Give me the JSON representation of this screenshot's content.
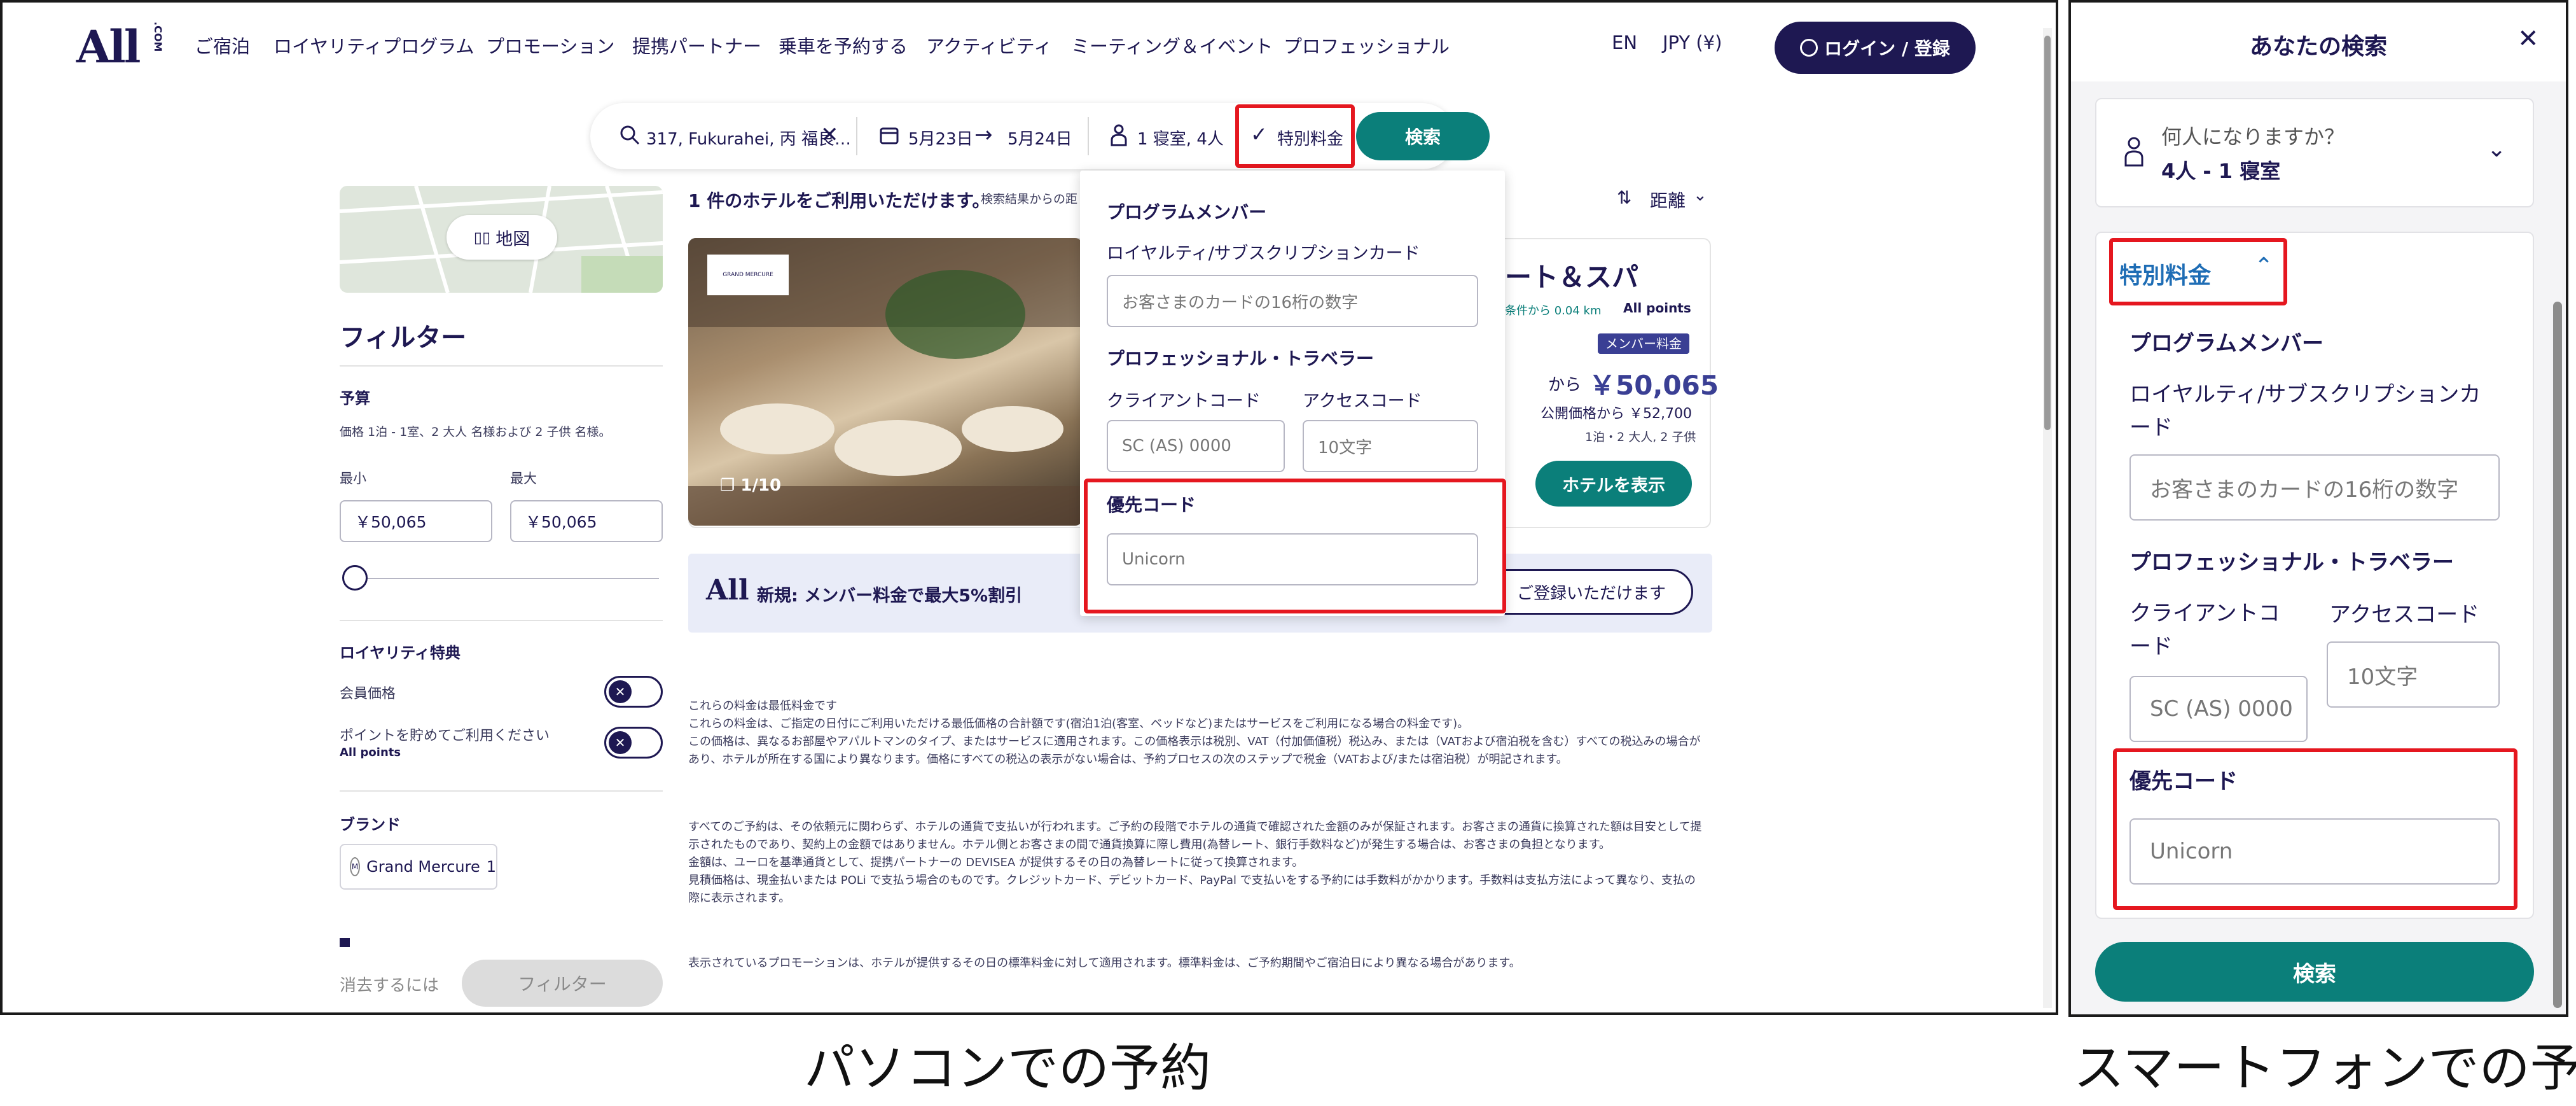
{
  "desktop": {
    "logo": "All",
    "logo_suffix": ".COM",
    "nav": [
      "ご宿泊",
      "ロイヤリティプログラム",
      "プロモーション",
      "提携パートナー",
      "乗車を予約する",
      "アクティビティ",
      "ミーティング＆イベント",
      "プロフェッショナル"
    ],
    "lang": "EN",
    "currency": "JPY (¥)",
    "login_label": "ログイン / 登録",
    "search": {
      "destination": "317, Fukurahei, 丙 福良…",
      "checkin": "5月23日",
      "checkout": "5月24日",
      "guests": "1 寝室, 4人",
      "special_rate": "特別料金",
      "search_button": "検索"
    },
    "map_button": "地図",
    "filters": {
      "title": "フィルター",
      "budget_title": "予算",
      "budget_note": "価格 1泊 - 1室、2 大人 名様および 2 子供 名様。",
      "min_label": "最小",
      "max_label": "最大",
      "min_value": "￥50,065",
      "max_value": "￥50,065",
      "loyalty_title": "ロイヤリティ特典",
      "member_price": "会員価格",
      "earn_points": "ポイントを貯めてご利用ください",
      "all_points": "All points",
      "brand_title": "ブランド",
      "brand_item": "Grand Mercure",
      "brand_count": "1",
      "clear_label": "消去するには",
      "filter_button": "フィルター"
    },
    "results": {
      "count_text": "1 件のホテルをご利用いただけます。",
      "sort_note": "検索結果からの距",
      "sort_label": "距離",
      "hotel_name_tail": "ート＆スパ",
      "distance_text": "条件から 0.04 km",
      "points_label": "All points",
      "member_badge": "メンバー料金",
      "price_prefix": "から",
      "price": "￥50,065",
      "public_price": "公開価格から ￥52,700",
      "stay_note": "1泊・2 大人, 2 子供",
      "view_button": "ホテルを表示",
      "image_counter": "1/10",
      "image_logo": "GRAND MERCURE",
      "promo_text": "新規: メンバー料金で最大5%割引",
      "promo_button": "ご登録いただけます"
    },
    "dropdown": {
      "program_member": "プログラムメンバー",
      "loyalty_card_label": "ロイヤルティ/サブスクリプションカード",
      "loyalty_card_placeholder": "お客さまのカードの16桁の数字",
      "pro_traveler": "プロフェッショナル・トラベラー",
      "client_code_label": "クライアントコード",
      "access_code_label": "アクセスコード",
      "client_code_placeholder": "SC (AS) 0000",
      "access_code_placeholder": "10文字",
      "priority_code_label": "優先コード",
      "priority_code_placeholder": "Unicorn"
    },
    "disclaimers": [
      "これらの料金は最低料金です",
      "これらの料金は、ご指定の日付にご利用いただける最低価格の合計額です(宿泊1泊(客室、ベッドなど)またはサービスをご利用になる場合の料金です)。",
      "この価格は、異なるお部屋やアパルトマンのタイプ、またはサービスに適用されます。この価格表示は税別、VAT（付加価値税）税込み、または（VATおよび宿泊税を含む）すべての税込みの場合があり、ホテルが所在する国により異なります。価格にすべての税込の表示がない場合は、予約プロセスの次のステップで税金（VATおよび/または宿泊税）が明記されます。",
      "すべてのご予約は、その依頼元に関わらず、ホテルの通貨で支払いが行われます。ご予約の段階でホテルの通貨で確認された金額のみが保証されます。お客さまの通貨に換算された額は目安として提示されたものであり、契約上の金額ではありません。ホテル側とお客さまの間で通貨換算に際し費用(為替レート、銀行手数料など)が発生する場合は、お客さまの負担となります。",
      "金額は、ユーロを基準通貨として、提携パートナーの DEVISEA が提供するその日の為替レートに従って換算されます。",
      "見積価格は、現金払いまたは POLi で支払う場合のものです。クレジットカード、デビットカード、PayPal で支払いをする予約には手数料がかかります。手数料は支払方法によって異なり、支払の際に表示されます。",
      "表示されているプロモーションは、ホテルが提供するその日の標準料金に対して適用されます。標準料金は、ご予約期間やご宿泊日により異なる場合があります。"
    ]
  },
  "mobile": {
    "title": "あなたの検索",
    "guests_question": "何人になりますか？",
    "guests_value": "4人 - 1 寝室",
    "special_rate": "特別料金",
    "program_member": "プログラムメンバー",
    "loyalty_card_label": "ロイヤルティ/サブスクリプションカード",
    "loyalty_card_placeholder": "お客さまのカードの16桁の数字",
    "pro_traveler": "プロフェッショナル・トラベラー",
    "client_code_label": "クライアントコード",
    "access_code_label": "アクセスコード",
    "client_code_placeholder": "SC (AS) 0000",
    "access_code_placeholder": "10文字",
    "priority_code_label": "優先コード",
    "priority_code_placeholder": "Unicorn",
    "search_button": "検索"
  },
  "captions": {
    "desktop": "パソコンでの予約",
    "mobile": "スマートフォンでの予約"
  },
  "colors": {
    "navy": "#1e1852",
    "teal": "#0b7f7a",
    "highlight": "#e5171f"
  }
}
